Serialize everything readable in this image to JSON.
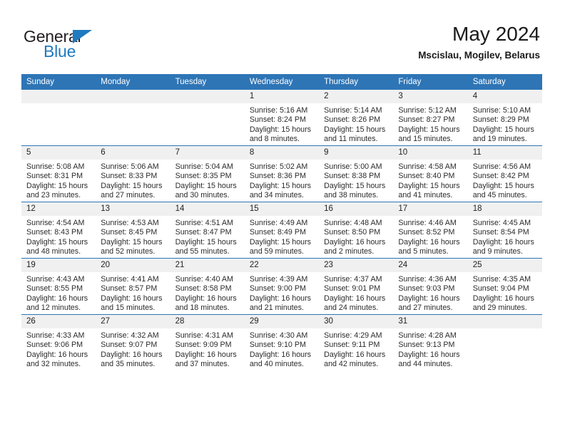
{
  "brand": {
    "name_top": "General",
    "name_bottom": "Blue",
    "accent_color": "#1f7ac0"
  },
  "header": {
    "month_title": "May 2024",
    "location": "Mscislau, Mogilev, Belarus"
  },
  "theme": {
    "header_blue": "#2e75b6",
    "daynum_band": "#f0f0f0",
    "text": "#2b2b2b"
  },
  "weekday_headers": [
    "Sunday",
    "Monday",
    "Tuesday",
    "Wednesday",
    "Thursday",
    "Friday",
    "Saturday"
  ],
  "weeks": [
    [
      {
        "day": "",
        "lines": []
      },
      {
        "day": "",
        "lines": []
      },
      {
        "day": "",
        "lines": []
      },
      {
        "day": "1",
        "lines": [
          "Sunrise: 5:16 AM",
          "Sunset: 8:24 PM",
          "Daylight: 15 hours",
          "and 8 minutes."
        ]
      },
      {
        "day": "2",
        "lines": [
          "Sunrise: 5:14 AM",
          "Sunset: 8:26 PM",
          "Daylight: 15 hours",
          "and 11 minutes."
        ]
      },
      {
        "day": "3",
        "lines": [
          "Sunrise: 5:12 AM",
          "Sunset: 8:27 PM",
          "Daylight: 15 hours",
          "and 15 minutes."
        ]
      },
      {
        "day": "4",
        "lines": [
          "Sunrise: 5:10 AM",
          "Sunset: 8:29 PM",
          "Daylight: 15 hours",
          "and 19 minutes."
        ]
      }
    ],
    [
      {
        "day": "5",
        "lines": [
          "Sunrise: 5:08 AM",
          "Sunset: 8:31 PM",
          "Daylight: 15 hours",
          "and 23 minutes."
        ]
      },
      {
        "day": "6",
        "lines": [
          "Sunrise: 5:06 AM",
          "Sunset: 8:33 PM",
          "Daylight: 15 hours",
          "and 27 minutes."
        ]
      },
      {
        "day": "7",
        "lines": [
          "Sunrise: 5:04 AM",
          "Sunset: 8:35 PM",
          "Daylight: 15 hours",
          "and 30 minutes."
        ]
      },
      {
        "day": "8",
        "lines": [
          "Sunrise: 5:02 AM",
          "Sunset: 8:36 PM",
          "Daylight: 15 hours",
          "and 34 minutes."
        ]
      },
      {
        "day": "9",
        "lines": [
          "Sunrise: 5:00 AM",
          "Sunset: 8:38 PM",
          "Daylight: 15 hours",
          "and 38 minutes."
        ]
      },
      {
        "day": "10",
        "lines": [
          "Sunrise: 4:58 AM",
          "Sunset: 8:40 PM",
          "Daylight: 15 hours",
          "and 41 minutes."
        ]
      },
      {
        "day": "11",
        "lines": [
          "Sunrise: 4:56 AM",
          "Sunset: 8:42 PM",
          "Daylight: 15 hours",
          "and 45 minutes."
        ]
      }
    ],
    [
      {
        "day": "12",
        "lines": [
          "Sunrise: 4:54 AM",
          "Sunset: 8:43 PM",
          "Daylight: 15 hours",
          "and 48 minutes."
        ]
      },
      {
        "day": "13",
        "lines": [
          "Sunrise: 4:53 AM",
          "Sunset: 8:45 PM",
          "Daylight: 15 hours",
          "and 52 minutes."
        ]
      },
      {
        "day": "14",
        "lines": [
          "Sunrise: 4:51 AM",
          "Sunset: 8:47 PM",
          "Daylight: 15 hours",
          "and 55 minutes."
        ]
      },
      {
        "day": "15",
        "lines": [
          "Sunrise: 4:49 AM",
          "Sunset: 8:49 PM",
          "Daylight: 15 hours",
          "and 59 minutes."
        ]
      },
      {
        "day": "16",
        "lines": [
          "Sunrise: 4:48 AM",
          "Sunset: 8:50 PM",
          "Daylight: 16 hours",
          "and 2 minutes."
        ]
      },
      {
        "day": "17",
        "lines": [
          "Sunrise: 4:46 AM",
          "Sunset: 8:52 PM",
          "Daylight: 16 hours",
          "and 5 minutes."
        ]
      },
      {
        "day": "18",
        "lines": [
          "Sunrise: 4:45 AM",
          "Sunset: 8:54 PM",
          "Daylight: 16 hours",
          "and 9 minutes."
        ]
      }
    ],
    [
      {
        "day": "19",
        "lines": [
          "Sunrise: 4:43 AM",
          "Sunset: 8:55 PM",
          "Daylight: 16 hours",
          "and 12 minutes."
        ]
      },
      {
        "day": "20",
        "lines": [
          "Sunrise: 4:41 AM",
          "Sunset: 8:57 PM",
          "Daylight: 16 hours",
          "and 15 minutes."
        ]
      },
      {
        "day": "21",
        "lines": [
          "Sunrise: 4:40 AM",
          "Sunset: 8:58 PM",
          "Daylight: 16 hours",
          "and 18 minutes."
        ]
      },
      {
        "day": "22",
        "lines": [
          "Sunrise: 4:39 AM",
          "Sunset: 9:00 PM",
          "Daylight: 16 hours",
          "and 21 minutes."
        ]
      },
      {
        "day": "23",
        "lines": [
          "Sunrise: 4:37 AM",
          "Sunset: 9:01 PM",
          "Daylight: 16 hours",
          "and 24 minutes."
        ]
      },
      {
        "day": "24",
        "lines": [
          "Sunrise: 4:36 AM",
          "Sunset: 9:03 PM",
          "Daylight: 16 hours",
          "and 27 minutes."
        ]
      },
      {
        "day": "25",
        "lines": [
          "Sunrise: 4:35 AM",
          "Sunset: 9:04 PM",
          "Daylight: 16 hours",
          "and 29 minutes."
        ]
      }
    ],
    [
      {
        "day": "26",
        "lines": [
          "Sunrise: 4:33 AM",
          "Sunset: 9:06 PM",
          "Daylight: 16 hours",
          "and 32 minutes."
        ]
      },
      {
        "day": "27",
        "lines": [
          "Sunrise: 4:32 AM",
          "Sunset: 9:07 PM",
          "Daylight: 16 hours",
          "and 35 minutes."
        ]
      },
      {
        "day": "28",
        "lines": [
          "Sunrise: 4:31 AM",
          "Sunset: 9:09 PM",
          "Daylight: 16 hours",
          "and 37 minutes."
        ]
      },
      {
        "day": "29",
        "lines": [
          "Sunrise: 4:30 AM",
          "Sunset: 9:10 PM",
          "Daylight: 16 hours",
          "and 40 minutes."
        ]
      },
      {
        "day": "30",
        "lines": [
          "Sunrise: 4:29 AM",
          "Sunset: 9:11 PM",
          "Daylight: 16 hours",
          "and 42 minutes."
        ]
      },
      {
        "day": "31",
        "lines": [
          "Sunrise: 4:28 AM",
          "Sunset: 9:13 PM",
          "Daylight: 16 hours",
          "and 44 minutes."
        ]
      },
      {
        "day": "",
        "lines": []
      }
    ]
  ]
}
